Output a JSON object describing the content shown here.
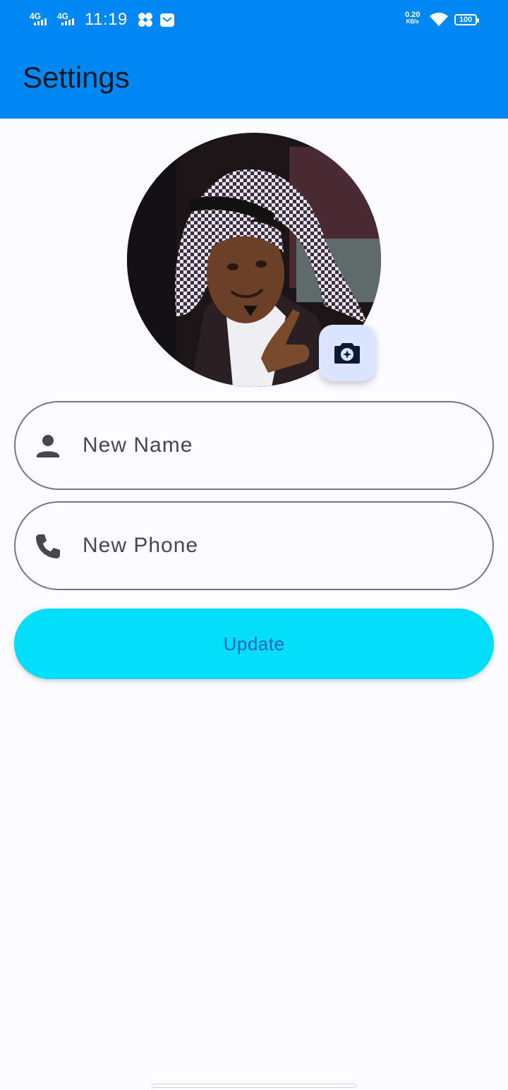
{
  "status_bar": {
    "network_1": "4G",
    "network_2": "4G",
    "time": "11:19",
    "speed_value": "0.20",
    "speed_unit": "KB/s",
    "battery": "100"
  },
  "app_bar": {
    "title": "Settings"
  },
  "profile": {
    "photo_icon": "camera-enhance-icon"
  },
  "form": {
    "name_placeholder": "New Name",
    "name_icon": "person-icon",
    "phone_placeholder": "New Phone",
    "phone_icon": "phone-icon",
    "update_label": "Update"
  },
  "colors": {
    "app_bar": "#0088f5",
    "button": "#00def9",
    "button_text": "#2a63b5",
    "field_border": "#74777f",
    "fab": "#dbe5ff"
  }
}
